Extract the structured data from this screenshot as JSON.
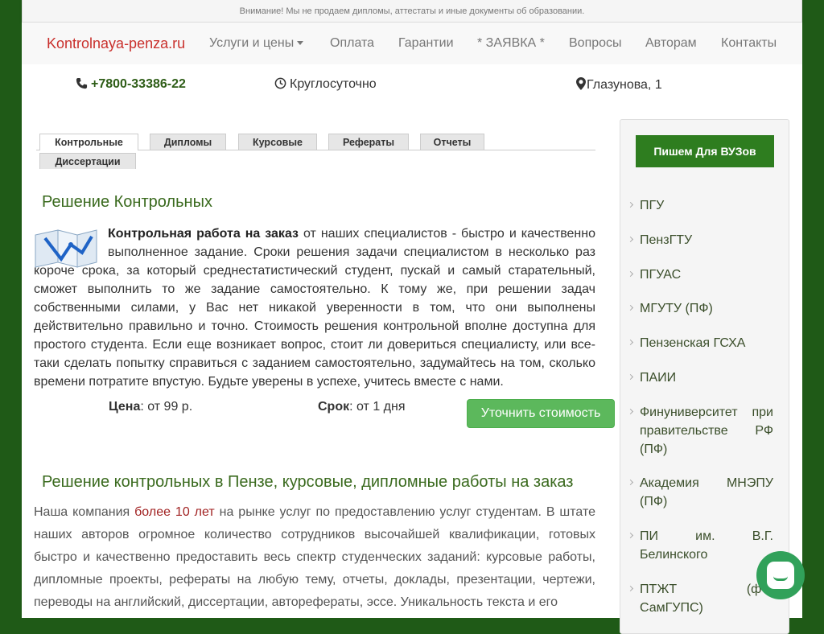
{
  "notice": "Внимание! Мы не продаем дипломы, аттестаты и иные документы об образовании.",
  "brand": "Kontrolnaya-penza.ru",
  "nav": [
    {
      "label": "Услуги и цены"
    },
    {
      "label": "Оплата"
    },
    {
      "label": "Гарантии"
    },
    {
      "label": "* ЗАЯВКА *"
    },
    {
      "label": "Вопросы"
    },
    {
      "label": "Авторам"
    },
    {
      "label": "Контакты"
    }
  ],
  "contacts": {
    "phone": "+7800-33386-22",
    "hours": "Круглосуточно",
    "address": "Глазунова, 1"
  },
  "tabs": [
    {
      "label": "Контрольные"
    },
    {
      "label": "Дипломы"
    },
    {
      "label": "Курсовые"
    },
    {
      "label": "Рефераты"
    },
    {
      "label": "Отчеты"
    },
    {
      "label": "Диссертации"
    }
  ],
  "main": {
    "title": "Решение Контрольных",
    "lead_bold": "Контрольная работа на заказ",
    "lead_text": " от наших специалистов - быстро и качественно выполненное задание. Сроки решения задачи специалистом в несколько раз короче срока, за который среднестатистический студент, пускай и самый старательный, сможет выполнить то же задание самостоятельно. К тому же, при решении задач собственными силами, у Вас нет никакой уверенности в том, что они выполнены действительно правильно и точно. Стоимость решения контрольной вполне доступна для простого студента. Если еще возникает вопрос, стоит ли довериться специалисту, или все-таки сделать попытку справиться с заданием самостоятельно, задумайтесь на том, сколько времени потратите впустую. Будьте уверены в успехе, учитесь вместе с нами.",
    "price_label": "Цена",
    "price_value": ": от 99 р.",
    "term_label": "Срок",
    "term_value": ": от 1 дня",
    "order_button": "Уточнить стоимость",
    "title2": "Решение контрольных в Пензе, курсовые, дипломные работы на заказ",
    "p2_start": "Наша компания ",
    "p2_highlight": " более 10 лет ",
    "p2_rest": " на рынке услуг по предоставлению услуг студентам. В штате наших авторов огромное количество сотрудников высочайшей квалификации, готовых быстро и качественно предоставить весь спектр студенческих заданий: курсовые работы, дипломные проекты, рефераты на любую тему, отчеты, доклады, презентации, чертежи, переводы на английский, диссертации, авторефераты, эссе. Уникальность текста и его"
  },
  "sidebar": {
    "heading": "Пишем Для ВУЗов",
    "items": [
      {
        "label": "ПГУ"
      },
      {
        "label": "ПензГТУ"
      },
      {
        "label": "ПГУАС"
      },
      {
        "label": "МГУТУ (ПФ)"
      },
      {
        "label": "Пензенская ГСХА"
      },
      {
        "label": "ПАИИ"
      },
      {
        "label": "Финуниверситет при правительстве РФ (ПФ)"
      },
      {
        "label": "Академия МНЭПУ (ПФ)"
      },
      {
        "label": "ПИ им. В.Г. Белинского"
      },
      {
        "label": "ПТЖТ (ф-л СамГУПС)"
      }
    ]
  },
  "colors": {
    "accent_green": "#5cb85c",
    "dark_green": "#2e7d1f",
    "brand_red": "#c9302c",
    "background": "#1f5a17"
  },
  "icons": {
    "phone": "phone-icon",
    "clock": "clock-icon",
    "location": "map-marker-icon",
    "chat": "chat-icon"
  }
}
